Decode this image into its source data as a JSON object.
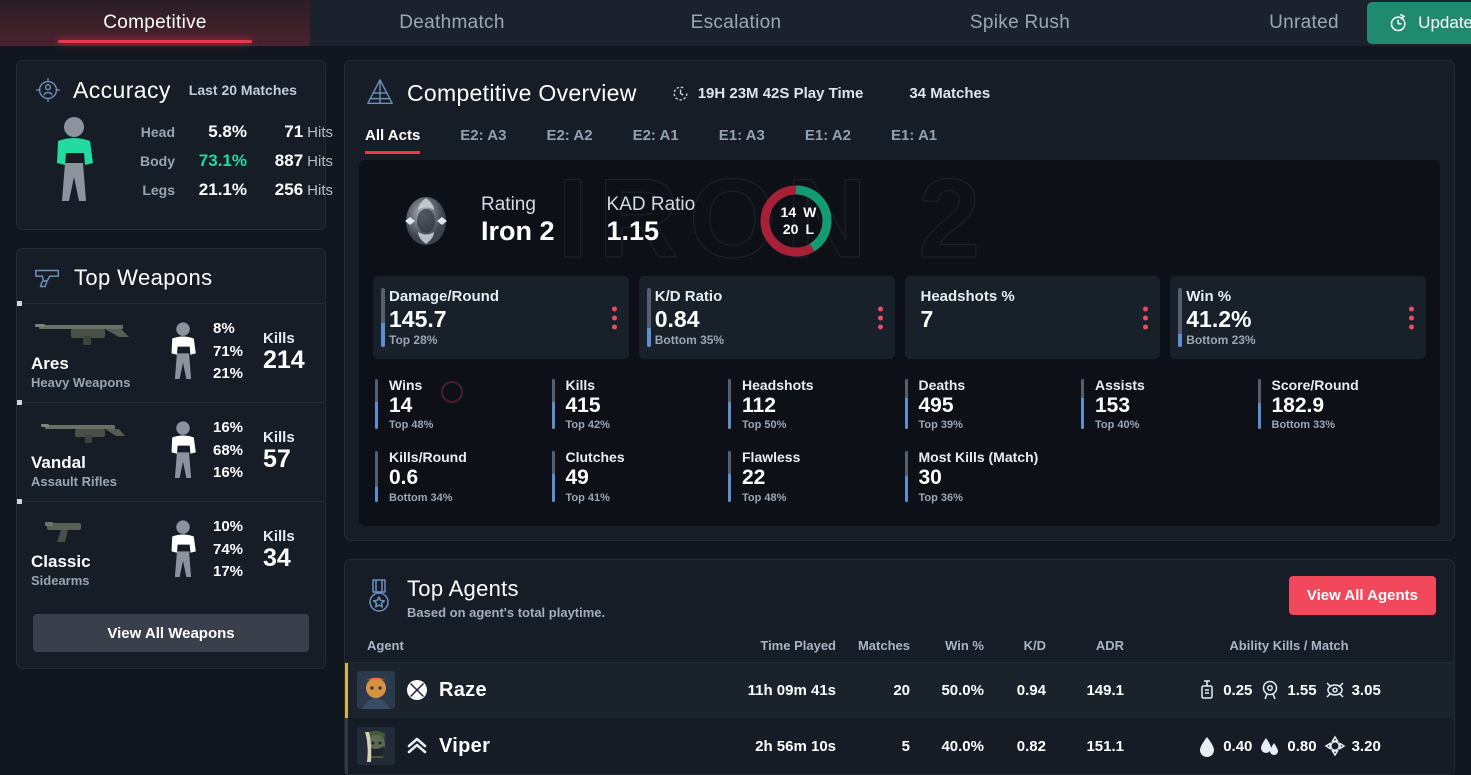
{
  "nav": {
    "tabs": [
      {
        "label": "Competitive",
        "active": true
      },
      {
        "label": "Deathmatch",
        "active": false
      },
      {
        "label": "Escalation",
        "active": false
      },
      {
        "label": "Spike Rush",
        "active": false
      },
      {
        "label": "Unrated",
        "active": false
      }
    ],
    "update_label": "Update",
    "update_icon": "refresh-timer-icon",
    "accent_red": "#e8394f",
    "update_green": "#1f8a6d"
  },
  "accuracy": {
    "icon": "accuracy-target-icon",
    "title": "Accuracy",
    "subtitle": "Last 20 Matches",
    "highlight_color": "#21dba0",
    "rows": [
      {
        "label": "Head",
        "pct": "5.8%",
        "hits": "71",
        "hits_label": "Hits",
        "highlight": false
      },
      {
        "label": "Body",
        "pct": "73.1%",
        "hits": "887",
        "hits_label": "Hits",
        "highlight": true
      },
      {
        "label": "Legs",
        "pct": "21.1%",
        "hits": "256",
        "hits_label": "Hits",
        "highlight": false
      }
    ]
  },
  "top_weapons": {
    "icon": "pistol-icon",
    "title": "Top Weapons",
    "kills_label": "Kills",
    "weapons": [
      {
        "name": "Ares",
        "category": "Heavy Weapons",
        "head": "8%",
        "body": "71%",
        "legs": "21%",
        "kills": "214"
      },
      {
        "name": "Vandal",
        "category": "Assault Rifles",
        "head": "16%",
        "body": "68%",
        "legs": "16%",
        "kills": "57"
      },
      {
        "name": "Classic",
        "category": "Sidearms",
        "head": "10%",
        "body": "74%",
        "legs": "17%",
        "kills": "34"
      }
    ],
    "view_all_label": "View All Weapons"
  },
  "overview": {
    "icon": "rank-pyramid-icon",
    "title": "Competitive Overview",
    "clock_icon": "clock-icon",
    "playtime": "19H 23M 42S Play Time",
    "matches": "34 Matches",
    "watermark": "IRON 2",
    "acts": [
      {
        "label": "All Acts",
        "active": true
      },
      {
        "label": "E2: A3",
        "active": false
      },
      {
        "label": "E2: A2",
        "active": false
      },
      {
        "label": "E2: A1",
        "active": false
      },
      {
        "label": "E1: A3",
        "active": false
      },
      {
        "label": "E1: A2",
        "active": false
      },
      {
        "label": "E1: A1",
        "active": false
      }
    ],
    "rating": {
      "label": "Rating",
      "value": "Iron 2",
      "badge_icon": "iron-rank-badge-icon"
    },
    "kad": {
      "label": "KAD Ratio",
      "value": "1.15"
    },
    "winloss": {
      "wins": "14",
      "wins_label": "W",
      "losses": "20",
      "losses_label": "L",
      "win_fraction": 0.412,
      "win_color": "#119c72",
      "loss_color": "#a62138"
    },
    "big_cards": [
      {
        "label": "Damage/Round",
        "value": "145.7",
        "percentile": "Top 28%",
        "fill": 0.28,
        "has_accent": true
      },
      {
        "label": "K/D Ratio",
        "value": "0.84",
        "percentile": "Bottom 35%",
        "fill": 0.35,
        "has_accent": true
      },
      {
        "label": "Headshots %",
        "value": "7",
        "percentile": "",
        "fill": 0,
        "has_accent": false
      },
      {
        "label": "Win %",
        "value": "41.2%",
        "percentile": "Bottom 23%",
        "fill": 0.23,
        "has_accent": true
      }
    ],
    "small_stats": [
      {
        "label": "Wins",
        "value": "14",
        "percentile": "Top 48%",
        "fill": 0.55
      },
      {
        "label": "Kills",
        "value": "415",
        "percentile": "Top 42%",
        "fill": 0.55
      },
      {
        "label": "Headshots",
        "value": "112",
        "percentile": "Top 50%",
        "fill": 0.55
      },
      {
        "label": "Deaths",
        "value": "495",
        "percentile": "Top 39%",
        "fill": 0.62
      },
      {
        "label": "Assists",
        "value": "153",
        "percentile": "Top 40%",
        "fill": 0.62
      },
      {
        "label": "Score/Round",
        "value": "182.9",
        "percentile": "Bottom 33%",
        "fill": 0.52
      },
      {
        "label": "Kills/Round",
        "value": "0.6",
        "percentile": "Bottom 34%",
        "fill": 0.28
      },
      {
        "label": "Clutches",
        "value": "49",
        "percentile": "Top 41%",
        "fill": 0.55
      },
      {
        "label": "Flawless",
        "value": "22",
        "percentile": "Top 48%",
        "fill": 0.55
      },
      {
        "label": "Most Kills (Match)",
        "value": "30",
        "percentile": "Top 36%",
        "fill": 0.5
      }
    ]
  },
  "top_agents": {
    "icon": "medal-star-icon",
    "title": "Top Agents",
    "subtitle": "Based on agent's total playtime.",
    "view_all_label": "View All Agents",
    "columns": [
      "Agent",
      "Time Played",
      "Matches",
      "Win %",
      "K/D",
      "ADR",
      "Ability Kills / Match"
    ],
    "rows": [
      {
        "name": "Raze",
        "role_icon": "raze-blast-icon",
        "bar_color": "#d8b24a",
        "portrait_colors": [
          "#d8913f",
          "#3d4a5e"
        ],
        "time_played": "11h 09m 41s",
        "matches": "20",
        "win_pct": "50.0%",
        "kd": "0.94",
        "adr": "149.1",
        "abilities": [
          {
            "icon": "boom-bot-icon",
            "value": "0.25"
          },
          {
            "icon": "paint-shells-icon",
            "value": "1.55"
          },
          {
            "icon": "showstopper-icon",
            "value": "3.05"
          }
        ]
      },
      {
        "name": "Viper",
        "role_icon": "viper-chevron-icon",
        "bar_color": "#2f3a49",
        "portrait_colors": [
          "#4b5a4a",
          "#26303f"
        ],
        "time_played": "2h 56m 10s",
        "matches": "5",
        "win_pct": "40.0%",
        "kd": "0.82",
        "adr": "151.1",
        "abilities": [
          {
            "icon": "snake-bite-icon",
            "value": "0.40"
          },
          {
            "icon": "poison-cloud-icon",
            "value": "0.80"
          },
          {
            "icon": "vipers-pit-icon",
            "value": "3.20"
          }
        ]
      }
    ]
  }
}
